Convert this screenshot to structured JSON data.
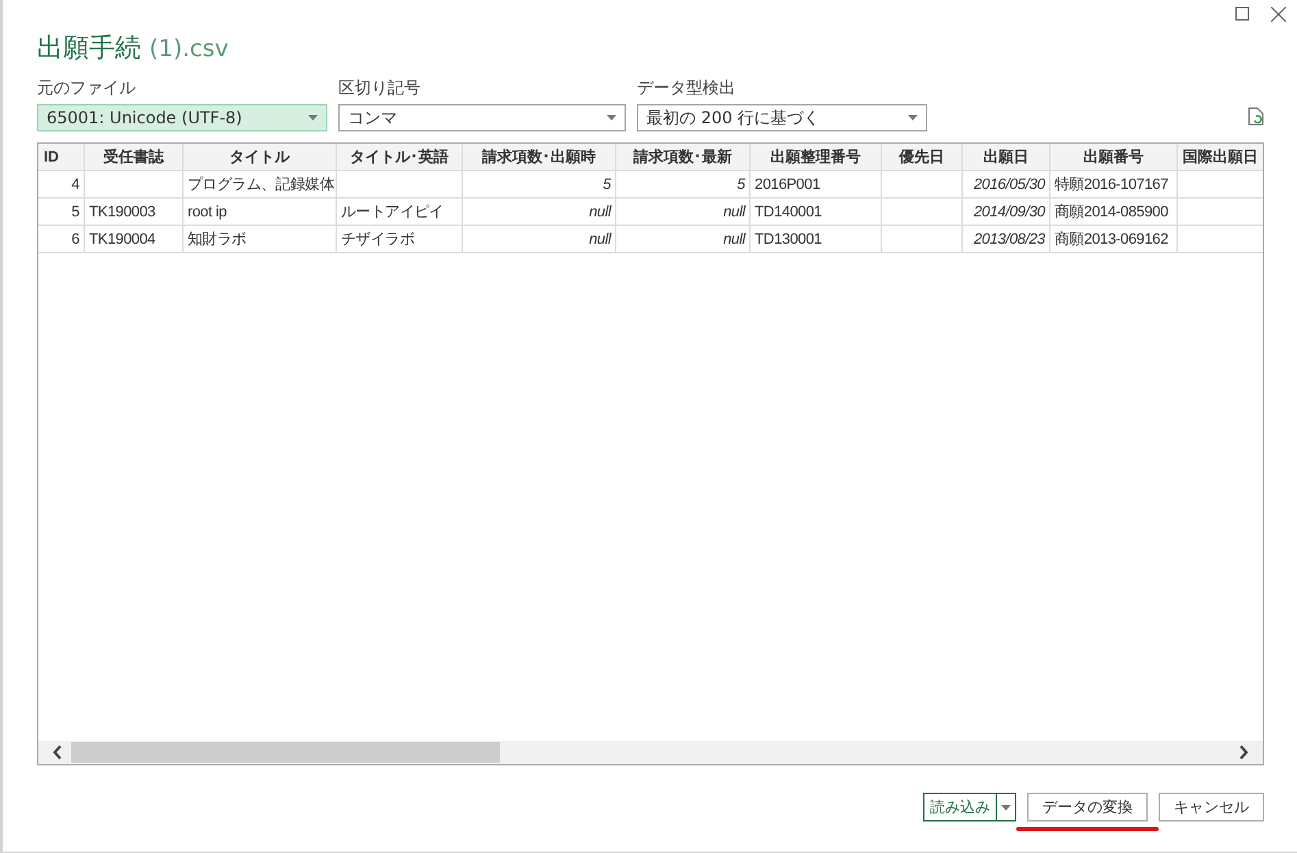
{
  "window": {
    "title": "出願手続",
    "title_suffix": "(1).csv"
  },
  "options": [
    {
      "label": "元のファイル",
      "value": "65001: Unicode (UTF-8)",
      "focused": true
    },
    {
      "label": "区切り記号",
      "value": "コンマ",
      "focused": false
    },
    {
      "label": "データ型検出",
      "value": "最初の 200 行に基づく",
      "focused": false
    }
  ],
  "table": {
    "columns": [
      {
        "title": "ID",
        "kind": "id"
      },
      {
        "title": "受任書誌",
        "kind": "text"
      },
      {
        "title": "タイトル",
        "kind": "text"
      },
      {
        "title": "タイトル･英語",
        "kind": "text"
      },
      {
        "title": "請求項数･出願時",
        "kind": "number"
      },
      {
        "title": "請求項数･最新",
        "kind": "number"
      },
      {
        "title": "出願整理番号",
        "kind": "text"
      },
      {
        "title": "優先日",
        "kind": "text"
      },
      {
        "title": "出願日",
        "kind": "date"
      },
      {
        "title": "出願番号",
        "kind": "text"
      },
      {
        "title": "国際出願日",
        "kind": "text"
      }
    ],
    "rows": [
      [
        "4",
        null,
        "プログラム、記録媒体",
        null,
        "5",
        "5",
        "2016P001",
        null,
        "2016/05/30",
        "特願2016-107167",
        null
      ],
      [
        "5",
        "TK190003",
        "root  ip",
        "ルートアイピイ",
        "null",
        "null",
        "TD140001",
        null,
        "2014/09/30",
        "商願2014-085900",
        null
      ],
      [
        "6",
        "TK190004",
        "知財ラボ",
        "チザイラボ",
        "null",
        "null",
        "TD130001",
        null,
        "2013/08/23",
        "商願2013-069162",
        null
      ]
    ]
  },
  "buttons": [
    {
      "label": "読み込み",
      "kind": "split",
      "highlighted": false
    },
    {
      "label": "データの変換",
      "kind": "plain",
      "highlighted": true
    },
    {
      "label": "キャンセル",
      "kind": "plain",
      "highlighted": false
    }
  ]
}
